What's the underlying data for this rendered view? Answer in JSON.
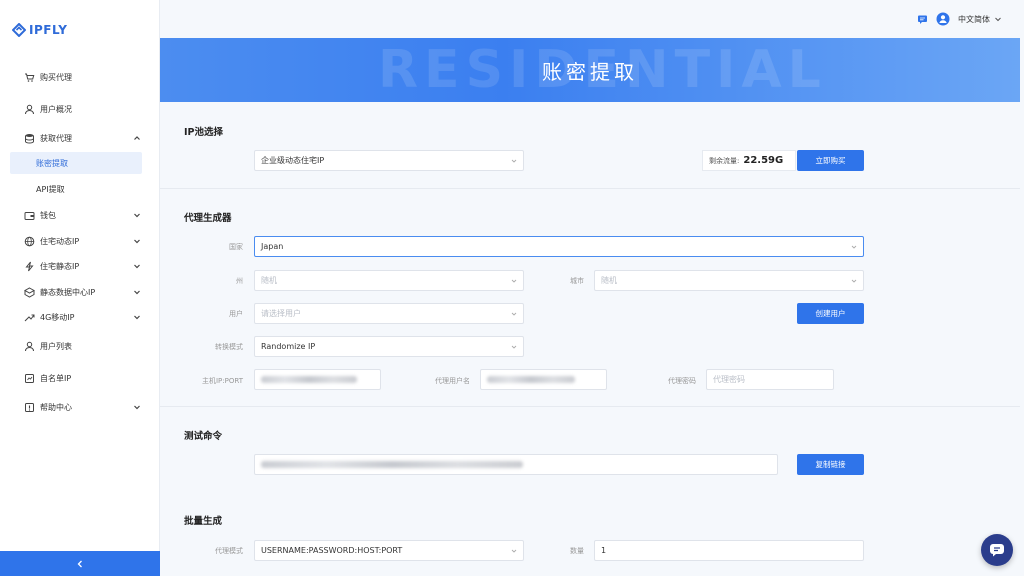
{
  "brand": {
    "name": "IPFLY"
  },
  "sidebar": {
    "items": [
      {
        "label": "购买代理",
        "icon": "cart-icon"
      },
      {
        "label": "用户概况",
        "icon": "user-icon"
      },
      {
        "label": "获取代理",
        "icon": "database-icon",
        "expanded": true
      },
      {
        "label": "账密提取",
        "active": true
      },
      {
        "label": "API提取"
      },
      {
        "label": "钱包",
        "icon": "wallet-icon"
      },
      {
        "label": "住宅动态IP",
        "icon": "globe-icon"
      },
      {
        "label": "住宅静态IP",
        "icon": "bolt-icon"
      },
      {
        "label": "静态数据中心IP",
        "icon": "server-icon"
      },
      {
        "label": "4G移动IP",
        "icon": "signal-icon"
      },
      {
        "label": "用户列表",
        "icon": "users-icon"
      },
      {
        "label": "自名单IP",
        "icon": "list-icon"
      },
      {
        "label": "帮助中心",
        "icon": "help-icon"
      }
    ]
  },
  "topbar": {
    "language": "中文简体"
  },
  "banner": {
    "title": "账密提取",
    "bg_text": "RESIDENTIAL"
  },
  "ip_pool": {
    "section_title": "IP池选择",
    "selected": "企业级动态住宅IP",
    "traffic_label": "剩余流量:",
    "traffic_value": "22.59G",
    "buy_button": "立即购买"
  },
  "generator": {
    "section_title": "代理生成器",
    "country_label": "国家",
    "country_value": "Japan",
    "state_label": "州",
    "state_placeholder": "随机",
    "city_label": "城市",
    "city_placeholder": "随机",
    "user_label": "用户",
    "user_placeholder": "请选择用户",
    "create_user_button": "创建用户",
    "rotation_label": "转换模式",
    "rotation_value": "Randomize IP",
    "host_label": "主机IP:PORT",
    "proxy_user_label": "代理用户名",
    "proxy_pass_label": "代理密码",
    "proxy_pass_placeholder": "代理密码"
  },
  "test": {
    "section_title": "测试命令",
    "copy_button": "复制链接"
  },
  "batch": {
    "section_title": "批量生成",
    "mode_label": "代理模式",
    "mode_value": "USERNAME:PASSWORD:HOST:PORT",
    "count_label": "数量",
    "count_value": "1"
  },
  "colors": {
    "accent": "#2f74ea",
    "brand": "#2f6bd8",
    "chat": "#2b3d8c"
  }
}
